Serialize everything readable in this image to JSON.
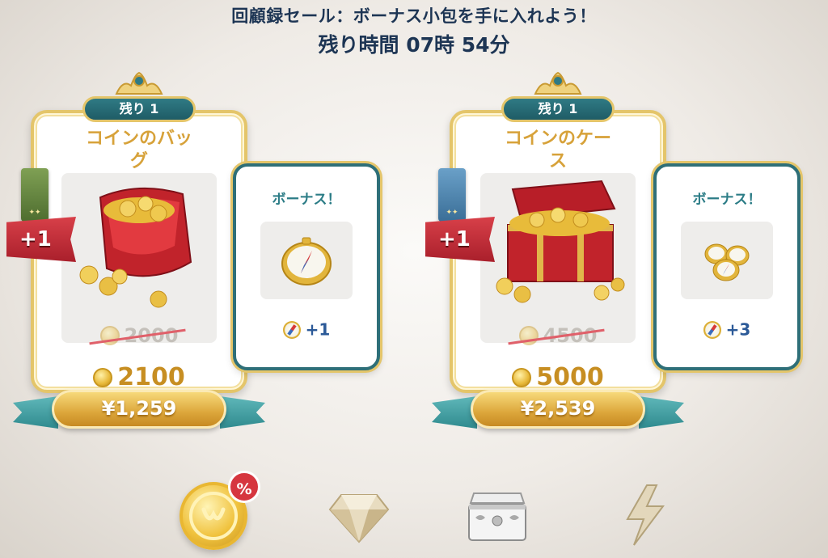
{
  "header": {
    "title": "回顧録セール：ボーナス小包を手に入れよう！",
    "timer": "残り時間 07時 54分"
  },
  "offers": [
    {
      "remaining": "残り 1",
      "name_line1": "コインのバッ",
      "name_line2": "グ",
      "tag_plus": "+1",
      "old_amount": "2000",
      "new_amount": "2100",
      "price": "¥1,259",
      "bonus_title": "ボーナス！",
      "bonus_value": "+1",
      "item_icon": "coin-bag-icon",
      "bonus_icon": "compass-icon"
    },
    {
      "remaining": "残り 1",
      "name_line1": "コインのケー",
      "name_line2": "ス",
      "tag_plus": "+1",
      "old_amount": "4500",
      "new_amount": "5000",
      "price": "¥2,539",
      "bonus_title": "ボーナス！",
      "bonus_value": "+3",
      "item_icon": "coin-chest-icon",
      "bonus_icon": "compass-stack-icon"
    }
  ],
  "tabs": [
    {
      "icon": "coin-sale-icon",
      "badge": "%",
      "selected": true
    },
    {
      "icon": "gem-icon",
      "selected": false
    },
    {
      "icon": "chest-icon",
      "selected": false
    },
    {
      "icon": "lightning-icon",
      "selected": false
    }
  ],
  "colors": {
    "title_text": "#1d3554",
    "name_gold": "#d7a23a",
    "teal": "#2e6f78",
    "ribbon_red": "#d84049",
    "bonus_blue": "#2c5a98"
  }
}
